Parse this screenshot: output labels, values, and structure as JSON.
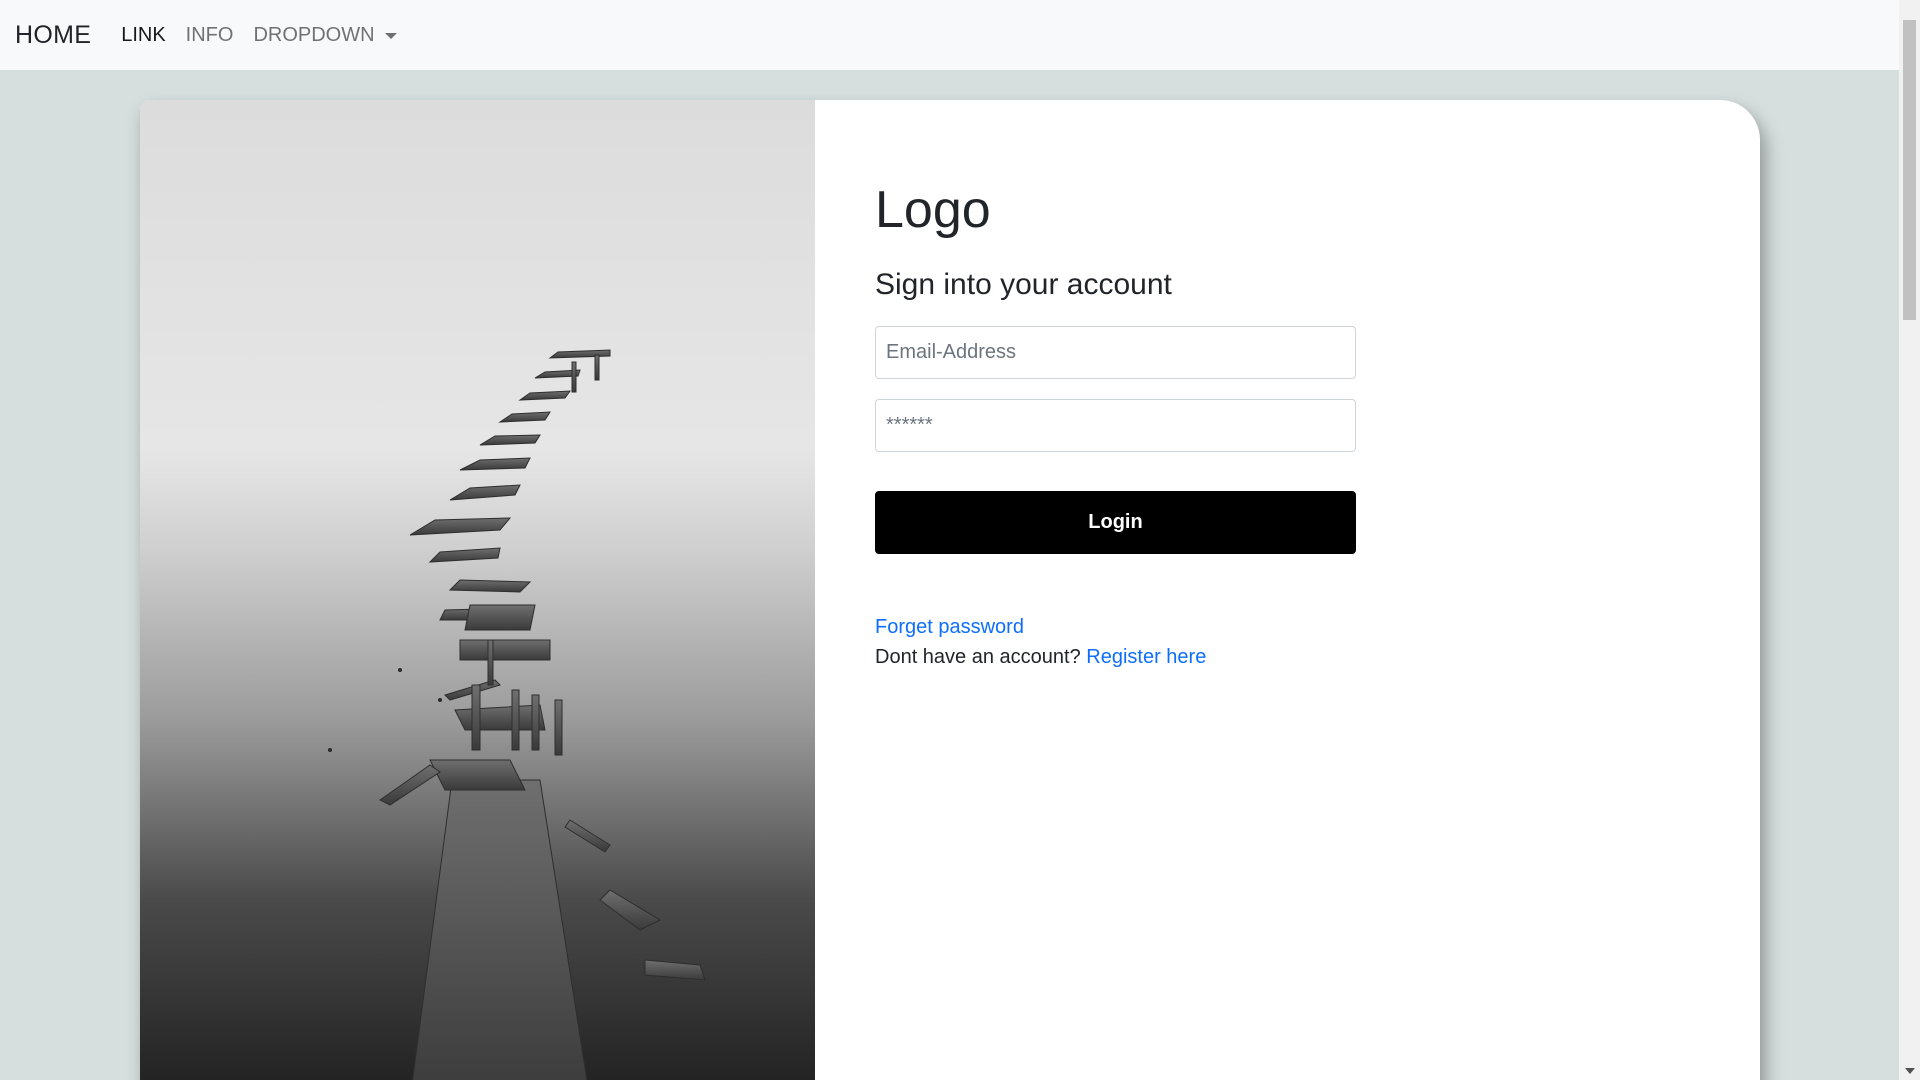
{
  "navbar": {
    "brand": "HOME",
    "links": [
      "LINK",
      "INFO",
      "DROPDOWN"
    ]
  },
  "login": {
    "logo": "Logo",
    "subtitle": "Sign into your account",
    "email_placeholder": "Email-Address",
    "password_placeholder": "******",
    "login_button": "Login",
    "forgot_password": "Forget password",
    "no_account_text": "Dont have an account?",
    "register_link": "Register here"
  },
  "colors": {
    "page_background": "#d6dfde",
    "navbar_background": "#f8f9fa",
    "button_background": "#000000",
    "link": "#0d6efd"
  },
  "icons": {
    "dropdown": "caret-down-icon",
    "scroll_down": "arrow-down-icon"
  }
}
